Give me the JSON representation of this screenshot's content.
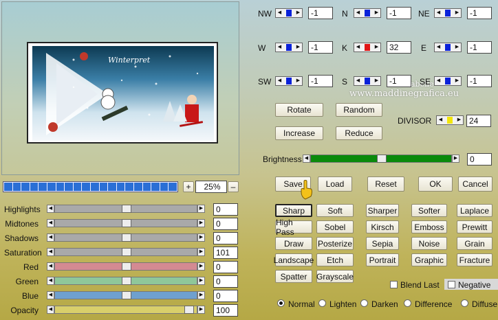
{
  "preview": {
    "caption": "Winterpret"
  },
  "watermark": {
    "line1": "Animabelle",
    "line2": "www.maddinegrafica.eu"
  },
  "zoom": {
    "plus": "+",
    "minus": "–",
    "value": "25%"
  },
  "kernel": {
    "labels": {
      "NW": "NW",
      "N": "N",
      "NE": "NE",
      "W": "W",
      "K": "K",
      "E": "E",
      "SW": "SW",
      "S": "S",
      "SE": "SE"
    },
    "values": {
      "NW": "-1",
      "N": "-1",
      "NE": "-1",
      "W": "-1",
      "K": "32",
      "E": "-1",
      "SW": "-1",
      "S": "-1",
      "SE": "-1"
    }
  },
  "buttons": {
    "rotate": "Rotate",
    "random": "Random",
    "increase": "Increase",
    "reduce": "Reduce",
    "save": "Save",
    "load": "Load",
    "reset": "Reset",
    "ok": "OK",
    "cancel": "Cancel"
  },
  "divisor": {
    "label": "DIVISOR",
    "value": "24"
  },
  "brightness": {
    "label": "Brightness",
    "value": "0"
  },
  "sliders": [
    {
      "label": "Highlights",
      "value": "0"
    },
    {
      "label": "Midtones",
      "value": "0"
    },
    {
      "label": "Shadows",
      "value": "0"
    },
    {
      "label": "Saturation",
      "value": "101"
    },
    {
      "label": "Red",
      "value": "0"
    },
    {
      "label": "Green",
      "value": "0"
    },
    {
      "label": "Blue",
      "value": "0"
    },
    {
      "label": "Opacity",
      "value": "100"
    }
  ],
  "filters": [
    "Sharp",
    "Soft",
    "Sharper",
    "Softer",
    "Laplace",
    "High Pass",
    "Sobel",
    "Kirsch",
    "Emboss",
    "Prewitt",
    "Draw",
    "Posterize",
    "Sepia",
    "Noise",
    "Grain",
    "Landscape",
    "Etch",
    "Portrait",
    "Graphic",
    "Fracture",
    "Spatter",
    "Grayscale"
  ],
  "checks": {
    "blend_last": "Blend Last",
    "negative": "Negative"
  },
  "modes": [
    "Normal",
    "Lighten",
    "Darken",
    "Difference",
    "Diffuse"
  ],
  "colors": {
    "red": "#d48a92",
    "green": "#8fc79a",
    "blue": "#6fa0cf",
    "opacity": "#d9cf6a",
    "brightness": "#0a8a0a",
    "neutral": "#a9a9a9",
    "kernel_blue": "#0a22d9",
    "kernel_red": "#e01515",
    "divisor_yellow": "#f2e60a"
  }
}
